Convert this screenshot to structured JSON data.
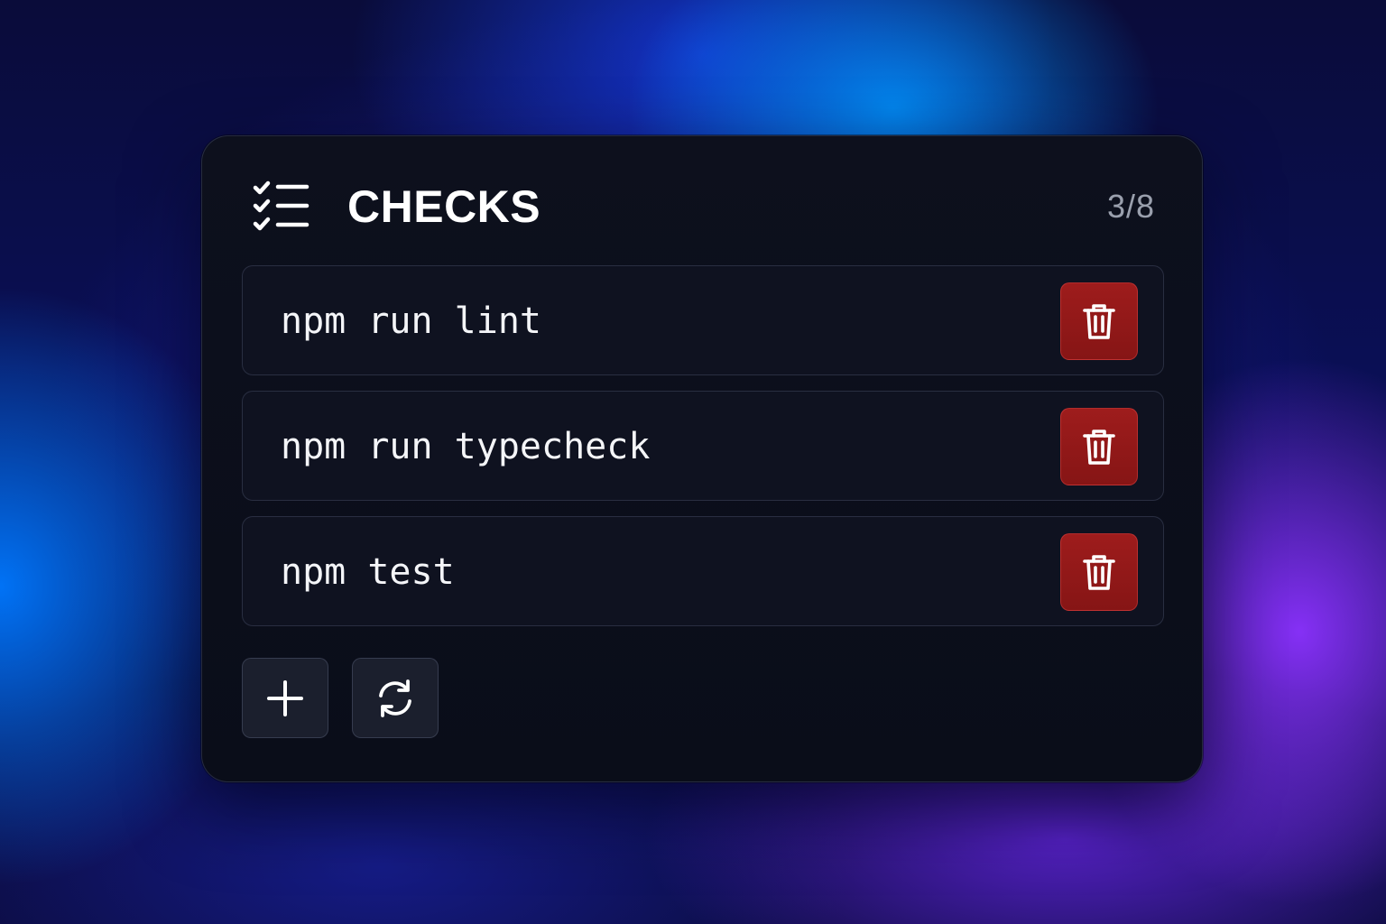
{
  "panel": {
    "title": "CHECKS",
    "counter": "3/8",
    "title_icon": "checklist-icon"
  },
  "checks": [
    {
      "command": "npm run lint",
      "action_icon": "trash-icon"
    },
    {
      "command": "npm run typecheck",
      "action_icon": "trash-icon"
    },
    {
      "command": "npm test",
      "action_icon": "trash-icon"
    }
  ],
  "toolbar": {
    "add_icon": "plus-icon",
    "refresh_icon": "refresh-icon"
  },
  "colors": {
    "panel_background": "#0c0f1b",
    "delete_button": "#951a1a",
    "text_primary": "#ffffff",
    "text_muted": "#9aa0ad"
  }
}
